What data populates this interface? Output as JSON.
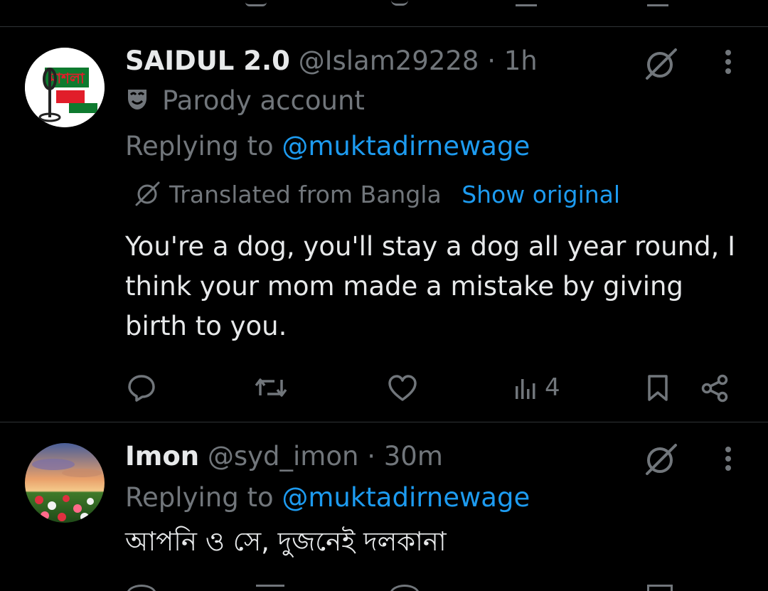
{
  "tweets": [
    {
      "display_name": "SAIDUL 2.0",
      "handle": "@Islam29228",
      "separator": "·",
      "time": "1h",
      "badge_text": "Parody account",
      "reply_prefix": "Replying to",
      "reply_to": "@muktadirnewage",
      "translated_label": "Translated from Bangla",
      "show_original": "Show original",
      "body": "You're a dog, you'll stay a dog all year round, I think your mom made a mistake by giving birth to you.",
      "views": "4",
      "avatar_text": "মাশলা"
    },
    {
      "display_name": "Imon",
      "handle": "@syd_imon",
      "separator": "·",
      "time": "30m",
      "reply_prefix": "Replying to",
      "reply_to": "@muktadirnewage",
      "body": "আপনি ও সে, দুজনেই দলকানা"
    }
  ],
  "colors": {
    "background": "#000000",
    "text": "#e7e9ea",
    "muted": "#71767b",
    "link": "#1d9bf0",
    "divider": "#2f3336"
  },
  "icons": [
    "grok-translate-icon",
    "more-icon",
    "parody-mask-icon",
    "reply-icon",
    "retweet-icon",
    "like-icon",
    "views-icon",
    "bookmark-icon",
    "share-icon"
  ]
}
